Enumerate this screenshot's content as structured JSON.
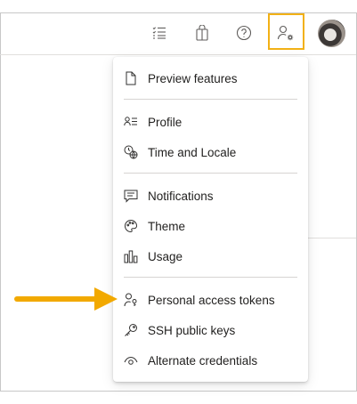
{
  "topbar": {
    "icons": [
      "task-list-icon",
      "shopping-bag-icon",
      "help-icon",
      "user-settings-icon"
    ],
    "highlight_color": "#f2b116"
  },
  "menu": {
    "items": [
      {
        "label": "Preview features",
        "icon": "document-icon"
      },
      {
        "label": "Profile",
        "icon": "contact-card-icon"
      },
      {
        "label": "Time and Locale",
        "icon": "globe-clock-icon"
      },
      {
        "label": "Notifications",
        "icon": "chat-bubble-icon"
      },
      {
        "label": "Theme",
        "icon": "palette-icon"
      },
      {
        "label": "Usage",
        "icon": "bar-chart-icon"
      },
      {
        "label": "Personal access tokens",
        "icon": "person-key-icon"
      },
      {
        "label": "SSH public keys",
        "icon": "ssh-key-icon"
      },
      {
        "label": "Alternate credentials",
        "icon": "eye-icon"
      }
    ]
  },
  "annotation": {
    "arrow_color": "#f2b116",
    "points_to": "Personal access tokens"
  }
}
